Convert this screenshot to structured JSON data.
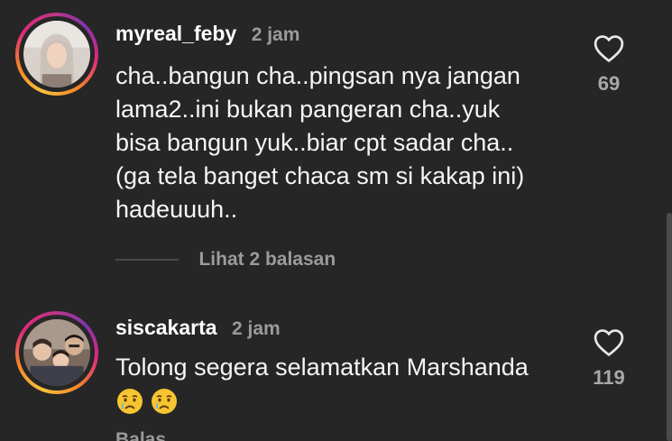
{
  "comments": [
    {
      "username": "myreal_feby",
      "time": "2 jam",
      "text": "cha..bangun cha..pingsan nya jangan\nlama2..ini bukan pangeran cha..yuk\nbisa bangun yuk..biar cpt sadar cha..\n(ga tela banget chaca sm si kakap ini)\nhadeuuuh..",
      "likes": "69",
      "replies_label": "Lihat 2 balasan",
      "like_icon": "heart-outline-icon"
    },
    {
      "username": "siscakarta",
      "time": "2 jam",
      "text": "Tolong segera selamatkan Marshanda",
      "emojis": [
        "crying-face-emoji",
        "crying-face-emoji"
      ],
      "likes": "119",
      "reply_label": "Balas",
      "like_icon": "heart-outline-icon"
    }
  ],
  "colors": {
    "background": "#262626",
    "text": "#f5f5f5",
    "muted": "#9b9b9b",
    "ring_gradient": [
      "#f9c23c",
      "#f58529",
      "#dd2a7b",
      "#8134af"
    ]
  }
}
